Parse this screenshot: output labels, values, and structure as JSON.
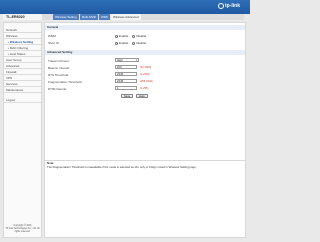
{
  "brand": {
    "logo_text": "tp-link"
  },
  "model": "TL-ER6020",
  "tabs": [
    {
      "label": "Wireless Setting"
    },
    {
      "label": "Multi-SSID"
    },
    {
      "label": "WDS"
    },
    {
      "label": "Wireless Advanced"
    }
  ],
  "sidebar": {
    "items": [
      {
        "label": "Network"
      },
      {
        "label": "Wireless"
      },
      {
        "label": "• Wireless Setting"
      },
      {
        "label": "• MAC Filtering"
      },
      {
        "label": "• Host Status"
      },
      {
        "label": "User Group"
      },
      {
        "label": "Advanced"
      },
      {
        "label": "Firewall"
      },
      {
        "label": "VPN"
      },
      {
        "label": "Services"
      },
      {
        "label": "Maintenance"
      },
      {
        "label": "Logout"
      }
    ],
    "copyright_line1": "Copyright © 2016",
    "copyright_line2": "TP-Link Technologies Co., Ltd. All",
    "copyright_line3": "rights reserved."
  },
  "general": {
    "heading": "General",
    "wmm": {
      "label": "WMM",
      "enable": "Enable",
      "disable": "Disable",
      "selected": "enable"
    },
    "short_gi": {
      "label": "Short GI",
      "enable": "Enable",
      "disable": "Disable",
      "selected": "enable"
    }
  },
  "advanced": {
    "heading": "Advanced Setting",
    "transmit_power": {
      "label": "Transmit Power:",
      "value": "High"
    },
    "beacon_interval": {
      "label": "Beacon Interval:",
      "value": "100",
      "hint": "(40-1000)"
    },
    "rts_threshold": {
      "label": "RTS Threshold:",
      "value": "2346",
      "hint": "(1-2346)"
    },
    "fragmentation": {
      "label": "Fragmentation Threshold:",
      "value": "2346",
      "hint": "(256-2346)"
    },
    "dtim_interval": {
      "label": "DTIM Interval:",
      "value": "1",
      "hint": "(1-255)"
    }
  },
  "buttons": {
    "save": "Save",
    "help": "Help"
  },
  "note": {
    "title": "Note:",
    "text": "The Fragmentation Threshold is unavailable if the mode is selected as 11n only or 11bgn mixed in Wireless Setting page."
  }
}
